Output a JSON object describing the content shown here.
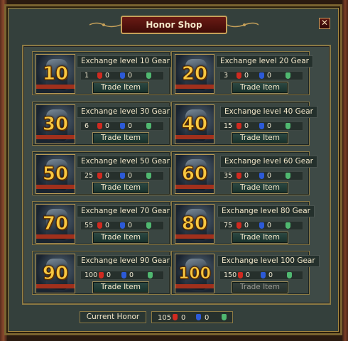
{
  "window": {
    "title": "Honor Shop",
    "close": "✕"
  },
  "items": [
    {
      "level_badge": "10",
      "label": "Exchange level 10 Gear",
      "honor": "1",
      "red": "0",
      "blue": "0",
      "button": "Trade Item"
    },
    {
      "level_badge": "20",
      "label": "Exchange level 20 Gear",
      "honor": "3",
      "red": "0",
      "blue": "0",
      "button": "Trade Item"
    },
    {
      "level_badge": "30",
      "label": "Exchange level 30 Gear",
      "honor": "6",
      "red": "0",
      "blue": "0",
      "button": "Trade Item"
    },
    {
      "level_badge": "40",
      "label": "Exchange level 40 Gear",
      "honor": "15",
      "red": "0",
      "blue": "0",
      "button": "Trade Item"
    },
    {
      "level_badge": "50",
      "label": "Exchange level 50 Gear",
      "honor": "25",
      "red": "0",
      "blue": "0",
      "button": "Trade Item"
    },
    {
      "level_badge": "60",
      "label": "Exchange level 60 Gear",
      "honor": "35",
      "red": "0",
      "blue": "0",
      "button": "Trade Item"
    },
    {
      "level_badge": "70",
      "label": "Exchange level 70 Gear",
      "honor": "55",
      "red": "0",
      "blue": "0",
      "button": "Trade Item"
    },
    {
      "level_badge": "80",
      "label": "Exchange level 80 Gear",
      "honor": "75",
      "red": "0",
      "blue": "0",
      "button": "Trade Item"
    },
    {
      "level_badge": "90",
      "label": "Exchange level 90 Gear",
      "honor": "100",
      "red": "0",
      "blue": "0",
      "button": "Trade Item"
    },
    {
      "level_badge": "100",
      "label": "Exchange level 100 Gear",
      "honor": "150",
      "red": "0",
      "blue": "0",
      "button": "Trade Item",
      "button_disabled": true
    }
  ],
  "footer": {
    "label": "Current Honor",
    "honor": "105",
    "red": "0",
    "blue": "0"
  },
  "colors": {
    "gold_border": "#8c7a44",
    "title_bg": "#6a1a14",
    "panel_bg": "#34403c",
    "badge_gold": "#f8c840",
    "red_shield": "#d02a20",
    "blue_shield": "#2c5ad8",
    "green_shield": "#50b870"
  }
}
